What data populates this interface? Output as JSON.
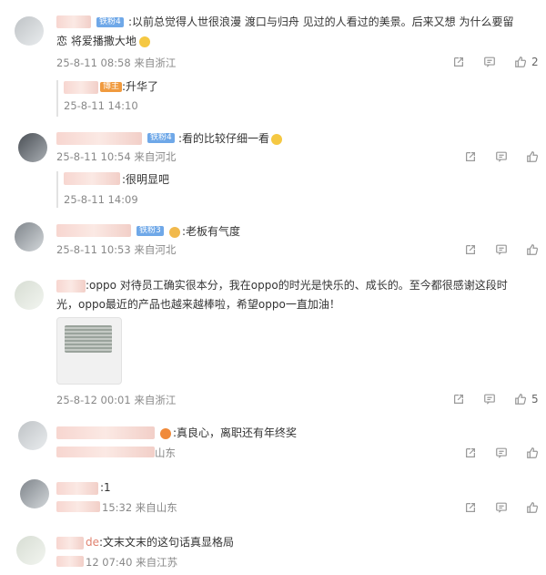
{
  "comments": [
    {
      "badge": "铁粉4",
      "text_line1": ":以前总觉得人世很浪漫 渡口与归舟 见过的人看过的美景。后来又想 为什么要留",
      "text_line2": "恋 将爱播撒大地",
      "meta": "25-8-11 08:58 来自浙江",
      "likes": "2"
    },
    {
      "reply": true,
      "badge": "博主",
      "text": ":升华了",
      "meta": "25-8-11 14:10"
    },
    {
      "badge": "铁粉4",
      "text": ":看的比较仔细一看",
      "meta": "25-8-11 10:54 来自河北"
    },
    {
      "reply": true,
      "text": ":很明显吧",
      "meta": "25-8-11 14:09"
    },
    {
      "badge": "铁粉3",
      "text": ":老板有气度",
      "meta": "25-8-11 10:53 来自河北"
    },
    {
      "text_line1": ":oppo 对待员工确实很本分，我在oppo的时光是快乐的、成长的。至今都很感谢这段时",
      "text_line2": "光，oppo最近的产品也越来越棒啦，希望oppo一直加油！",
      "meta": "25-8-12 00:01 来自浙江",
      "likes": "5"
    },
    {
      "text": ":真良心，离职还有年终奖",
      "meta": "山东"
    },
    {
      "text": ":1",
      "meta": "15:32 来自山东"
    },
    {
      "name_tail": "de",
      "text": ":文末文末的这句话真显格局",
      "meta": "12 07:40 来自江苏"
    }
  ]
}
